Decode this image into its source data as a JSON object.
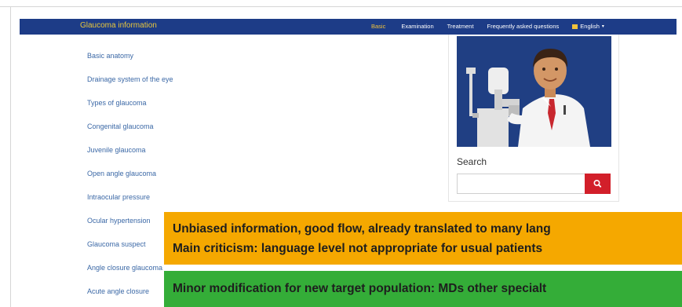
{
  "navbar": {
    "brand": "Glaucoma information",
    "items": [
      {
        "label": "Basic",
        "active": true
      },
      {
        "label": "Examination",
        "active": false
      },
      {
        "label": "Treatment",
        "active": false
      },
      {
        "label": "Frequently asked questions",
        "active": false
      }
    ],
    "language": "English",
    "colors": {
      "background": "#1d3c87",
      "brand": "#e9c73c",
      "active": "#f2c33b"
    }
  },
  "topics": [
    "Basic anatomy",
    "Drainage system of the eye",
    "Types of glaucoma",
    "Congenital glaucoma",
    "Juvenile glaucoma",
    "Open angle glaucoma",
    "Intraocular pressure",
    "Ocular hypertension",
    "Glaucoma suspect",
    "Angle closure glaucoma",
    "Acute angle closure"
  ],
  "sidebar_panel": {
    "illustration": "doctor-with-slit-lamp-illustration",
    "search_label": "Search",
    "search_value": "",
    "search_icon": "search-icon",
    "button_color": "#d21f2a"
  },
  "notes": {
    "orange": {
      "color": "#f5a800",
      "line1": "Unbiased information, good flow, already translated to many lang",
      "line2": "Main criticism: language level not appropriate for usual patients"
    },
    "green": {
      "color": "#34ad38",
      "line1": "Minor modification for new target population: MDs other specialt"
    }
  }
}
